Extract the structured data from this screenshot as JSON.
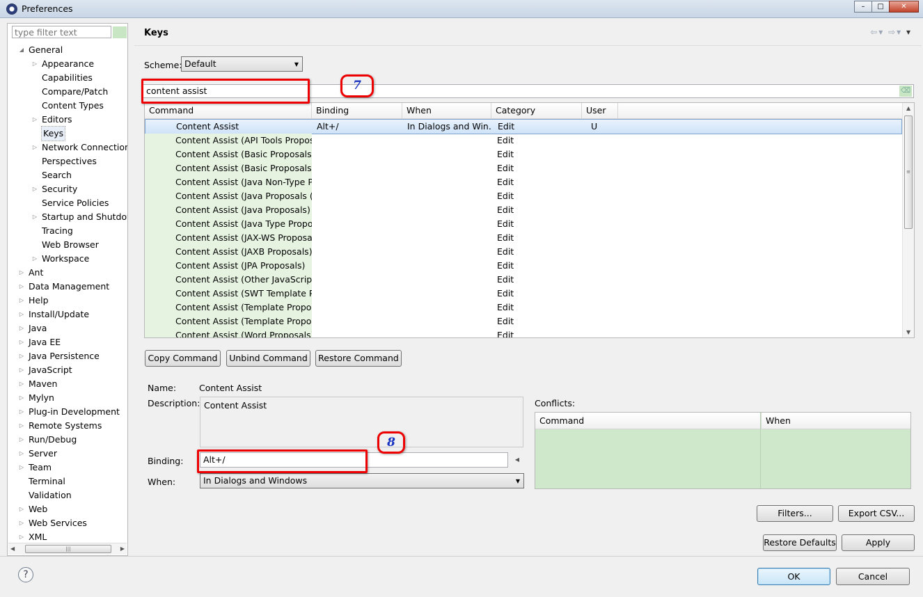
{
  "window": {
    "title": "Preferences",
    "minimize": "–",
    "maximize": "□",
    "close": "✕",
    "icon": "eclipse-icon"
  },
  "sidebar": {
    "filter_placeholder": "type filter text",
    "items": [
      {
        "label": "General",
        "level": 0,
        "state": "expanded"
      },
      {
        "label": "Appearance",
        "level": 1,
        "state": "collapsed"
      },
      {
        "label": "Capabilities",
        "level": 1,
        "state": "leaf"
      },
      {
        "label": "Compare/Patch",
        "level": 1,
        "state": "leaf"
      },
      {
        "label": "Content Types",
        "level": 1,
        "state": "leaf"
      },
      {
        "label": "Editors",
        "level": 1,
        "state": "collapsed"
      },
      {
        "label": "Keys",
        "level": 1,
        "state": "leaf",
        "selected": true
      },
      {
        "label": "Network Connections",
        "level": 1,
        "state": "collapsed"
      },
      {
        "label": "Perspectives",
        "level": 1,
        "state": "leaf"
      },
      {
        "label": "Search",
        "level": 1,
        "state": "leaf"
      },
      {
        "label": "Security",
        "level": 1,
        "state": "collapsed"
      },
      {
        "label": "Service Policies",
        "level": 1,
        "state": "leaf"
      },
      {
        "label": "Startup and Shutdow",
        "level": 1,
        "state": "collapsed"
      },
      {
        "label": "Tracing",
        "level": 1,
        "state": "leaf"
      },
      {
        "label": "Web Browser",
        "level": 1,
        "state": "leaf"
      },
      {
        "label": "Workspace",
        "level": 1,
        "state": "collapsed"
      },
      {
        "label": "Ant",
        "level": 0,
        "state": "collapsed"
      },
      {
        "label": "Data Management",
        "level": 0,
        "state": "collapsed"
      },
      {
        "label": "Help",
        "level": 0,
        "state": "collapsed"
      },
      {
        "label": "Install/Update",
        "level": 0,
        "state": "collapsed"
      },
      {
        "label": "Java",
        "level": 0,
        "state": "collapsed"
      },
      {
        "label": "Java EE",
        "level": 0,
        "state": "collapsed"
      },
      {
        "label": "Java Persistence",
        "level": 0,
        "state": "collapsed"
      },
      {
        "label": "JavaScript",
        "level": 0,
        "state": "collapsed"
      },
      {
        "label": "Maven",
        "level": 0,
        "state": "collapsed"
      },
      {
        "label": "Mylyn",
        "level": 0,
        "state": "collapsed"
      },
      {
        "label": "Plug-in Development",
        "level": 0,
        "state": "collapsed"
      },
      {
        "label": "Remote Systems",
        "level": 0,
        "state": "collapsed"
      },
      {
        "label": "Run/Debug",
        "level": 0,
        "state": "collapsed"
      },
      {
        "label": "Server",
        "level": 0,
        "state": "collapsed"
      },
      {
        "label": "Team",
        "level": 0,
        "state": "collapsed"
      },
      {
        "label": "Terminal",
        "level": 0,
        "state": "leaf"
      },
      {
        "label": "Validation",
        "level": 0,
        "state": "leaf"
      },
      {
        "label": "Web",
        "level": 0,
        "state": "collapsed"
      },
      {
        "label": "Web Services",
        "level": 0,
        "state": "collapsed"
      },
      {
        "label": "XML",
        "level": 0,
        "state": "collapsed"
      }
    ]
  },
  "main": {
    "heading": "Keys",
    "scheme_label": "Scheme:",
    "scheme_value": "Default",
    "search_value": "content assist",
    "table": {
      "columns": [
        "Command",
        "Binding",
        "When",
        "Category",
        "User"
      ],
      "rows": [
        {
          "command": "Content Assist",
          "binding": "Alt+/",
          "when": "In Dialogs and Win...",
          "category": "Edit",
          "user": "U",
          "selected": true
        },
        {
          "command": "Content Assist (API Tools Proposa",
          "binding": "",
          "when": "",
          "category": "Edit",
          "user": ""
        },
        {
          "command": "Content Assist (Basic Proposals)",
          "binding": "",
          "when": "",
          "category": "Edit",
          "user": ""
        },
        {
          "command": "Content Assist (Basic Proposals)",
          "binding": "",
          "when": "",
          "category": "Edit",
          "user": ""
        },
        {
          "command": "Content Assist (Java Non-Type Pro",
          "binding": "",
          "when": "",
          "category": "Edit",
          "user": ""
        },
        {
          "command": "Content Assist (Java Proposals (Ta",
          "binding": "",
          "when": "",
          "category": "Edit",
          "user": ""
        },
        {
          "command": "Content Assist (Java Proposals)",
          "binding": "",
          "when": "",
          "category": "Edit",
          "user": ""
        },
        {
          "command": "Content Assist (Java Type Proposa",
          "binding": "",
          "when": "",
          "category": "Edit",
          "user": ""
        },
        {
          "command": "Content Assist (JAX-WS Proposals",
          "binding": "",
          "when": "",
          "category": "Edit",
          "user": ""
        },
        {
          "command": "Content Assist (JAXB Proposals)",
          "binding": "",
          "when": "",
          "category": "Edit",
          "user": ""
        },
        {
          "command": "Content Assist (JPA Proposals)",
          "binding": "",
          "when": "",
          "category": "Edit",
          "user": ""
        },
        {
          "command": "Content Assist (Other JavaScript P",
          "binding": "",
          "when": "",
          "category": "Edit",
          "user": ""
        },
        {
          "command": "Content Assist (SWT Template Pro",
          "binding": "",
          "when": "",
          "category": "Edit",
          "user": ""
        },
        {
          "command": "Content Assist (Template Proposa",
          "binding": "",
          "when": "",
          "category": "Edit",
          "user": ""
        },
        {
          "command": "Content Assist (Template Proposa",
          "binding": "",
          "when": "",
          "category": "Edit",
          "user": ""
        },
        {
          "command": "Content Assist (Word Proposals)",
          "binding": "",
          "when": "",
          "category": "Edit",
          "user": ""
        }
      ]
    },
    "buttons": {
      "copy": "Copy Command",
      "unbind": "Unbind Command",
      "restore": "Restore Command"
    },
    "detail": {
      "name_label": "Name:",
      "name_value": "Content Assist",
      "description_label": "Description:",
      "description_value": "Content Assist",
      "binding_label": "Binding:",
      "binding_value": "Alt+/",
      "when_label": "When:",
      "when_value": "In Dialogs and Windows"
    },
    "conflicts": {
      "label": "Conflicts:",
      "columns": [
        "Command",
        "When"
      ]
    },
    "filters_button": "Filters...",
    "export_button": "Export CSV...",
    "restore_defaults_button": "Restore Defaults",
    "apply_button": "Apply"
  },
  "footer": {
    "ok": "OK",
    "cancel": "Cancel",
    "help": "?"
  },
  "annotations": {
    "step7": "7",
    "step8": "8",
    "color": "#e00000"
  }
}
